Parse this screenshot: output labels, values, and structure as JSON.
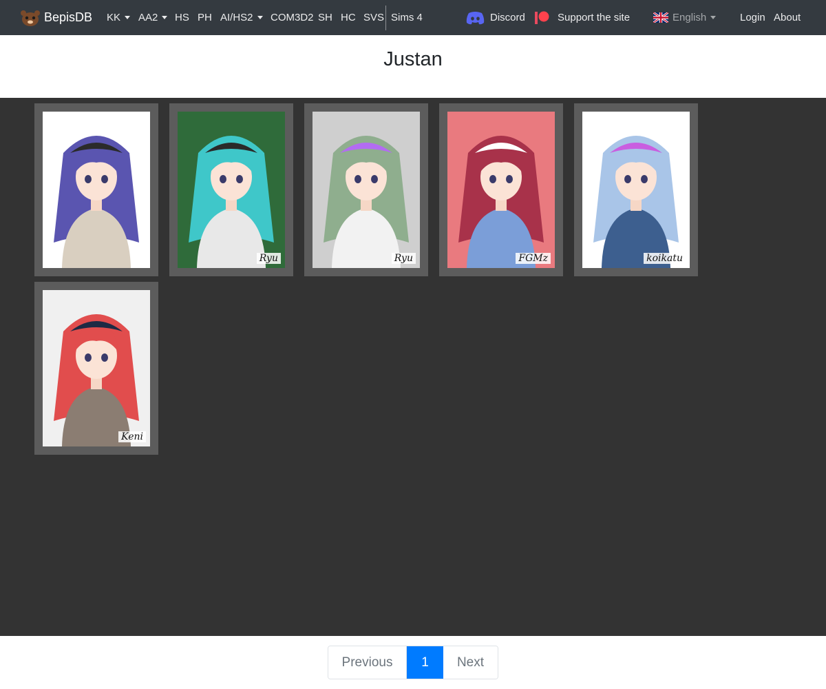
{
  "navbar": {
    "brand": "BepisDB",
    "items": [
      {
        "label": "KK",
        "dropdown": true
      },
      {
        "label": "AA2",
        "dropdown": true
      },
      {
        "label": "HS",
        "dropdown": false
      },
      {
        "label": "PH",
        "dropdown": false
      },
      {
        "label": "AI/HS2",
        "dropdown": true
      },
      {
        "label": "COM3D2",
        "dropdown": false
      },
      {
        "label": "SH",
        "dropdown": false
      },
      {
        "label": "HC",
        "dropdown": false
      },
      {
        "label": "SVS",
        "dropdown": false
      },
      {
        "label": "Sims 4",
        "dropdown": false
      }
    ],
    "discord": "Discord",
    "support": "Support the site",
    "language": "English",
    "login": "Login",
    "about": "About"
  },
  "page": {
    "title": "Justan"
  },
  "cards": [
    {
      "name": "card-1",
      "signature": "",
      "colors": {
        "bg": "#ffffff",
        "hair": "#5a55b0",
        "hat": "#2b2b2b",
        "cloth": "#d9cfc0"
      }
    },
    {
      "name": "card-2",
      "signature": "Ryu",
      "colors": {
        "bg": "#2f6b3a",
        "hair": "#3fc7c9",
        "hat": "#2a2a2a",
        "cloth": "#e8e8e8"
      }
    },
    {
      "name": "card-3",
      "signature": "Ryu",
      "colors": {
        "bg": "#cfcfcf",
        "hair": "#8fae8e",
        "hat": "#b36cf2",
        "cloth": "#f2f2f2"
      }
    },
    {
      "name": "card-4",
      "signature": "FGMz",
      "colors": {
        "bg": "#e97a7f",
        "hair": "#a8324a",
        "hat": "#ffffff",
        "cloth": "#7b9ed8"
      }
    },
    {
      "name": "card-5",
      "signature": "koikatu",
      "colors": {
        "bg": "#ffffff",
        "hair": "#a9c5e8",
        "hat": "#c95ee0",
        "cloth": "#3d5f8f"
      }
    },
    {
      "name": "card-6",
      "signature": "Keni",
      "colors": {
        "bg": "#f0f0f0",
        "hair": "#e14d4d",
        "hat": "#1e2a44",
        "cloth": "#8b7d72"
      }
    }
  ],
  "pagination": {
    "previous": "Previous",
    "current": "1",
    "next": "Next"
  }
}
